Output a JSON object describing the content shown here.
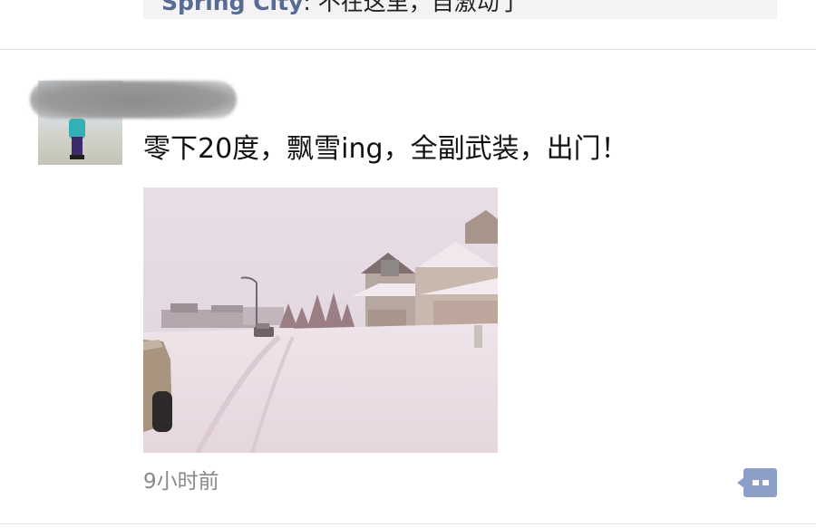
{
  "previous_post": {
    "comment_author": "Spring City",
    "comment_text": ": 不在这里，自激动了"
  },
  "post": {
    "author_name_censored": true,
    "text": "零下20度，飘雪ing，全副武装，出门！",
    "timestamp": "9小时前",
    "photo_icon": "snowy-street-photo",
    "comment_button_icon": "comment-bubble-icon"
  },
  "colors": {
    "link_blue": "#576b95",
    "comment_bg": "#f3f3f5",
    "timestamp_gray": "#8a8a8a",
    "comment_button": "#8d9fc9"
  }
}
